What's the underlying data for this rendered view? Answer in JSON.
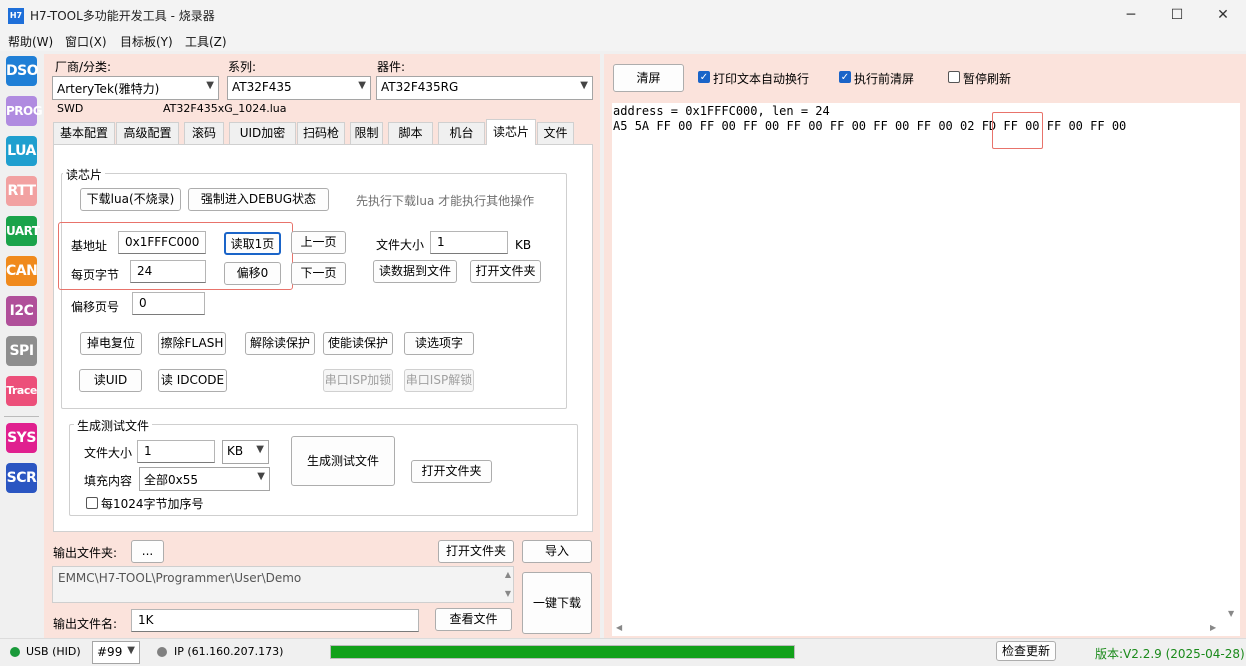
{
  "window": {
    "icon": "H7",
    "title": "H7-TOOL多功能开发工具 - 烧录器",
    "min_icon": "─",
    "max_icon": "☐",
    "close_icon": "✕"
  },
  "menu": [
    "帮助(W)",
    "窗口(X)",
    "目标板(Y)",
    "工具(Z)"
  ],
  "sidebar": [
    {
      "label": "DSO",
      "color": "#1f7fd6"
    },
    {
      "label": "PROG",
      "color": "#b08be0"
    },
    {
      "label": "LUA",
      "color": "#1f9fcf"
    },
    {
      "label": "RTT",
      "color": "#f2a1a1"
    },
    {
      "label": "UART",
      "color": "#1aa34a"
    },
    {
      "label": "CAN",
      "color": "#f08a1c"
    },
    {
      "label": "I2C",
      "color": "#b0509a"
    },
    {
      "label": "SPI",
      "color": "#8e8e8e"
    },
    {
      "label": "Trace",
      "color": "#ec4f7a"
    },
    {
      "label": "SYS",
      "color": "#e0208f"
    },
    {
      "label": "SCR",
      "color": "#2b56c2"
    }
  ],
  "selectors": {
    "vendor_label": "厂商/分类:",
    "vendor_value": "ArteryTek(雅特力)",
    "series_label": "系列:",
    "series_value": "AT32F435",
    "device_label": "器件:",
    "device_value": "AT32F435RG",
    "interface": "SWD",
    "lua_file": "AT32F435xG_1024.lua"
  },
  "tabs": [
    "基本配置",
    "高级配置",
    "滚码",
    "UID加密",
    "扫码枪",
    "限制",
    "脚本",
    "机台",
    "读芯片",
    "文件"
  ],
  "read_chip": {
    "group_title": "读芯片",
    "download_lua": "下载lua(不烧录)",
    "force_debug": "强制进入DEBUG状态",
    "hint": "先执行下载lua 才能执行其他操作",
    "base_addr_label": "基地址",
    "base_addr": "0x1FFFC000",
    "bytes_per_page_label": "每页字节",
    "bytes_per_page": "24",
    "read_page": "读取1页",
    "offset0": "偏移0",
    "prev_page": "上一页",
    "next_page": "下一页",
    "file_size_label": "文件大小",
    "file_size": "1",
    "kb": "KB",
    "read_to_file": "读数据到文件",
    "open_folder": "打开文件夹",
    "offset_page_label": "偏移页号",
    "offset_page": "0",
    "power_reset": "掉电复位",
    "erase_flash": "擦除FLASH",
    "unprotect": "解除读保护",
    "protect": "使能读保护",
    "option_bytes": "读选项字",
    "read_uid": "读UID",
    "read_idcode": "读 IDCODE",
    "isp_lock": "串口ISP加锁",
    "isp_unlock": "串口ISP解锁"
  },
  "gen_test": {
    "group_title": "生成测试文件",
    "size_label": "文件大小",
    "size": "1",
    "unit": "KB",
    "fill_label": "填充内容",
    "fill": "全部0x55",
    "seq_label": "每1024字节加序号",
    "generate": "生成测试文件",
    "open_folder": "打开文件夹"
  },
  "output": {
    "folder_label": "输出文件夹:",
    "browse": "...",
    "open_folder": "打开文件夹",
    "import": "导入",
    "path": "EMMC\\H7-TOOL\\Programmer\\User\\Demo",
    "name_label": "输出文件名:",
    "name": "1K",
    "view_file": "查看文件",
    "one_click": "一键下载"
  },
  "console": {
    "clear": "清屏",
    "wrap_label": "打印文本自动换行",
    "wrap_checked": true,
    "clear_before_label": "执行前清屏",
    "clear_before_checked": true,
    "pause_label": "暂停刷新",
    "pause_checked": false,
    "line1": "address = 0x1FFFC000, len = 24",
    "bytes": [
      "A5",
      "5A",
      "FF",
      "00",
      "FF",
      "00",
      "FF",
      "00",
      "FF",
      "00",
      "FF",
      "00",
      "FF",
      "00",
      "FF",
      "00",
      "02",
      "FD",
      "FF",
      "00",
      "FF",
      "00",
      "FF",
      "00"
    ]
  },
  "status": {
    "usb": "USB (HID)",
    "usb_color": "#1a9a3a",
    "device": "#99",
    "ip": "IP (61.160.207.173)",
    "ip_color": "#808080",
    "progress": 1.0,
    "progress_color": "#12a11a",
    "check_update": "检查更新",
    "version": "版本:V2.2.9 (2025-04-28)",
    "version_color": "#1a8a1a"
  }
}
